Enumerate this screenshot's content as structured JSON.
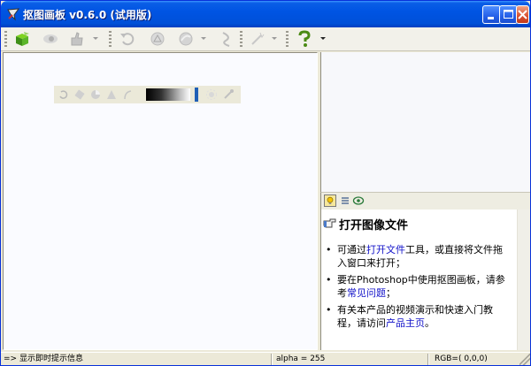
{
  "window": {
    "title": "抠图画板 v0.6.0 (试用版)"
  },
  "colors": {
    "titlebar": "#0054e3",
    "link": "#1010c8",
    "canvas_bg": "#fafbff",
    "toolbar_bg": "#f2f1ea"
  },
  "toolbar": {
    "icons": [
      "open-cube-icon",
      "eye-icon",
      "thumb-icon",
      "undo-icon",
      "lasso-icon",
      "ellipse-icon",
      "curve-icon",
      "wand-icon",
      "help-icon"
    ]
  },
  "info_panel": {
    "tabs": [
      "lightbulb-icon",
      "list-icon",
      "eye-icon"
    ],
    "heading": "打开图像文件",
    "items": [
      {
        "pre": "可通过",
        "link": "打开文件",
        "post": "工具，或直接将文件拖入窗口来打开；"
      },
      {
        "pre": "要在Photoshop中使用抠图画板，请参考",
        "link": "常见问题",
        "post": "；"
      },
      {
        "pre": "有关本产品的视频演示和快速入门教程，请访问",
        "link": "产品主页",
        "post": "。"
      }
    ]
  },
  "statusbar": {
    "hint": "=> 显示即时提示信息",
    "alpha": "alpha = 255",
    "rgb": "RGB=( 0,0,0)"
  }
}
